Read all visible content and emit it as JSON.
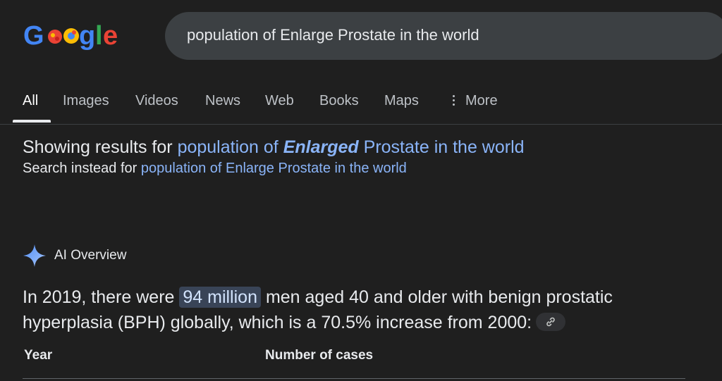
{
  "search": {
    "query": "population of Enlarge Prostate in the world"
  },
  "tabs": [
    {
      "label": "All",
      "active": true
    },
    {
      "label": "Images"
    },
    {
      "label": "Videos"
    },
    {
      "label": "News"
    },
    {
      "label": "Web"
    },
    {
      "label": "Books"
    },
    {
      "label": "Maps"
    },
    {
      "label": "More"
    }
  ],
  "spelling": {
    "showing_prefix": "Showing results for",
    "corrected_before": "population of",
    "corrected_word": "Enlarged",
    "corrected_after": "Prostate in the world",
    "instead_prefix": "Search instead for",
    "instead_query": "population of Enlarge Prostate in the world"
  },
  "ai_overview": {
    "title": "AI Overview",
    "text_before": "In 2019, there were",
    "highlight": "94 million",
    "text_after": "men aged 40 and older with benign prostatic hyperplasia (BPH) globally, which is a 70.5% increase from 2000:"
  },
  "table": {
    "headers": [
      "Year",
      "Number of cases"
    ]
  },
  "colors": {
    "background": "#1f1f1f",
    "link": "#8ab4f8",
    "highlight": "#394457"
  },
  "icons": [
    "google-logo",
    "sparkle-icon",
    "link-icon",
    "more-dots-icon"
  ]
}
